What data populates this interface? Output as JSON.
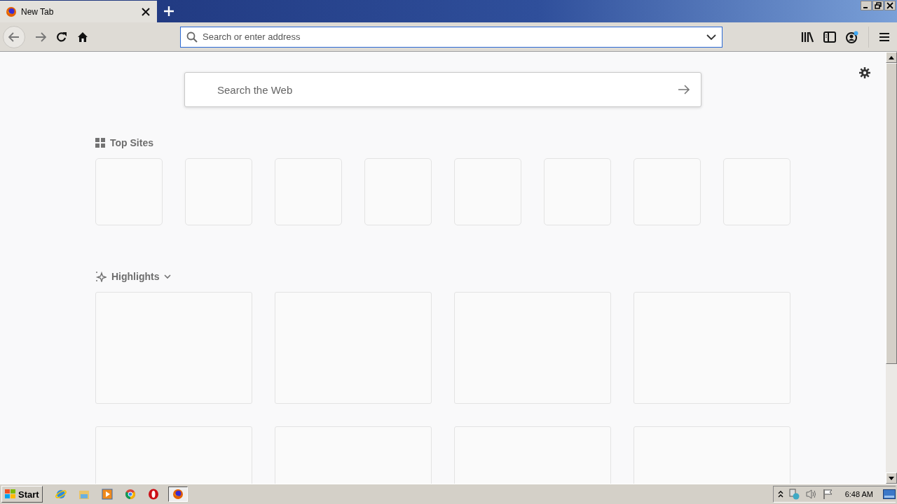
{
  "tabs": [
    {
      "title": "New Tab",
      "selected": true
    }
  ],
  "address_bar": {
    "placeholder": "Search or enter address"
  },
  "web_search": {
    "placeholder": "Search the Web"
  },
  "top_sites": {
    "title": "Top Sites",
    "tiles": [
      {
        "kind": "empty"
      },
      {
        "kind": "empty"
      },
      {
        "kind": "empty"
      },
      {
        "kind": "empty"
      },
      {
        "kind": "empty"
      },
      {
        "kind": "empty"
      },
      {
        "kind": "empty"
      },
      {
        "kind": "empty"
      }
    ]
  },
  "highlights": {
    "title": "Highlights",
    "cards": [
      {
        "kind": "empty"
      },
      {
        "kind": "empty"
      },
      {
        "kind": "empty"
      },
      {
        "kind": "empty"
      },
      {
        "kind": "empty"
      },
      {
        "kind": "empty"
      },
      {
        "kind": "empty"
      },
      {
        "kind": "empty"
      }
    ]
  },
  "taskbar": {
    "start": "Start",
    "apps": [
      {
        "kind": "ie",
        "selected": false
      },
      {
        "kind": "folder",
        "selected": false
      },
      {
        "kind": "media",
        "selected": false
      },
      {
        "kind": "chrome",
        "selected": false
      },
      {
        "kind": "opera",
        "selected": false
      },
      {
        "kind": "firefox",
        "selected": true
      }
    ],
    "clock": "6:48 AM"
  }
}
